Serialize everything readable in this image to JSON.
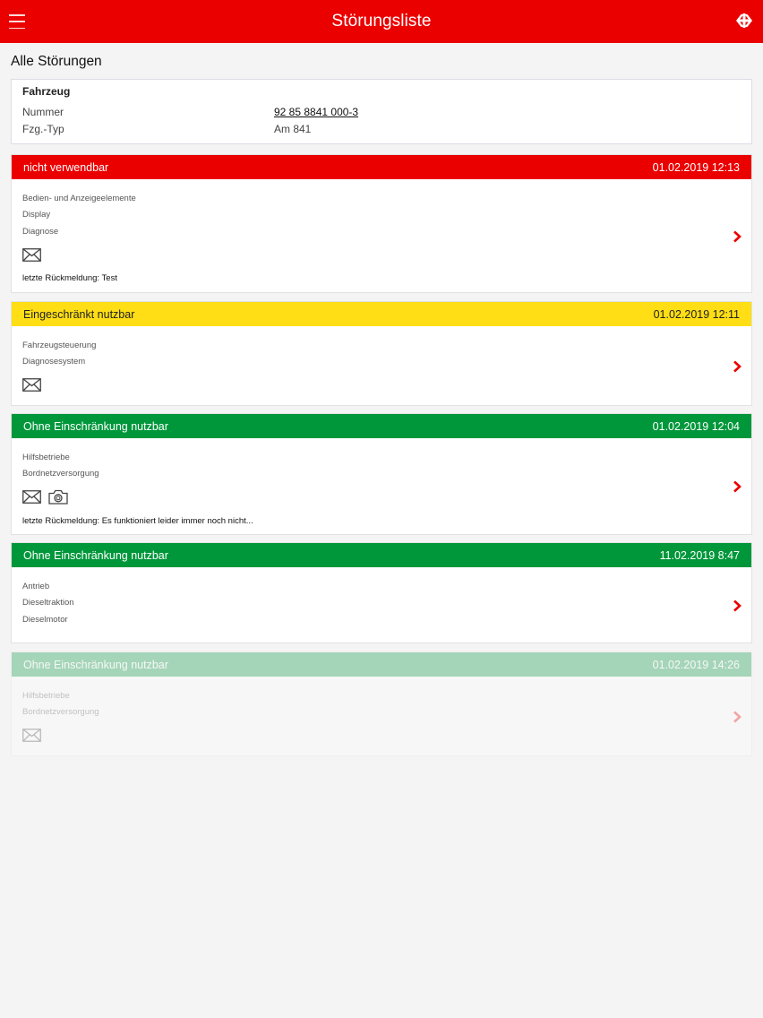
{
  "header": {
    "title": "Störungsliste",
    "menu_icon": "menu-icon",
    "logo_icon": "sbb-logo-icon",
    "color": "#eb0000"
  },
  "section_title": "Alle Störungen",
  "vehicle": {
    "heading": "Fahrzeug",
    "rows": [
      {
        "label": "Nummer",
        "value": "92 85 8841 000-3"
      },
      {
        "label": "Fzg.-Typ",
        "value": "Am 841"
      }
    ]
  },
  "faults": [
    {
      "status": "nicht verwendbar",
      "status_color": "#eb0000",
      "date": "01.02.2019 12:13",
      "lines": [
        "Bedien- und Anzeigeelemente",
        "Display",
        "Diagnose"
      ],
      "icons": [
        "mail-icon"
      ],
      "feedback": "letzte Rückmeldung: Test"
    },
    {
      "status": "Eingeschränkt nutzbar",
      "status_color": "#ffde15",
      "date": "01.02.2019 12:11",
      "lines": [
        "Fahrzeugsteuerung",
        "Diagnosesystem"
      ],
      "icons": [
        "mail-icon"
      ]
    },
    {
      "status": "Ohne Einschränkung nutzbar",
      "status_color": "#00973b",
      "date": "01.02.2019 12:04",
      "lines": [
        "Hilfsbetriebe",
        "Bordnetzversorgung"
      ],
      "icons": [
        "mail-icon",
        "camera-icon"
      ],
      "feedback": "letzte Rückmeldung: Es funktioniert leider immer noch nicht..."
    },
    {
      "status": "Ohne Einschränkung nutzbar",
      "status_color": "#00973b",
      "date": "11.02.2019 8:47",
      "lines": [
        "Antrieb",
        "Dieseltraktion",
        "Dieselmotor"
      ],
      "icons": []
    },
    {
      "status": "Ohne Einschränkung nutzbar",
      "status_color": "#00973b",
      "date": "01.02.2019 14:26",
      "lines": [
        "Hilfsbetriebe",
        "Bordnetzversorgung"
      ],
      "icons": [
        "mail-icon"
      ]
    }
  ]
}
